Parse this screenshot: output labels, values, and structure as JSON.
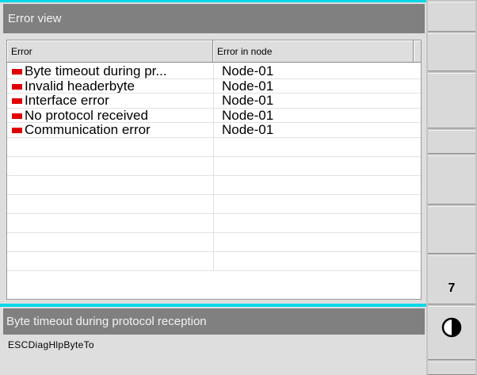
{
  "error_view": {
    "title": "Error view",
    "columns": {
      "error": "Error",
      "node": "Error in node"
    },
    "rows": [
      {
        "error": "Byte timeout during pr...",
        "node": "Node-01"
      },
      {
        "error": "Invalid headerbyte",
        "node": "Node-01"
      },
      {
        "error": "Interface error",
        "node": "Node-01"
      },
      {
        "error": "No protocol received",
        "node": "Node-01"
      },
      {
        "error": "Communication error",
        "node": "Node-01"
      }
    ]
  },
  "message": {
    "title": "Byte timeout during protocol reception",
    "id": "ESCDiagHlpByteTo"
  },
  "softkeys": {
    "key7_label": "7",
    "contrast_icon": "contrast-icon"
  },
  "colors": {
    "accent": "#00d8e8",
    "error_marker": "#e00000",
    "title_bar": "#808080"
  }
}
